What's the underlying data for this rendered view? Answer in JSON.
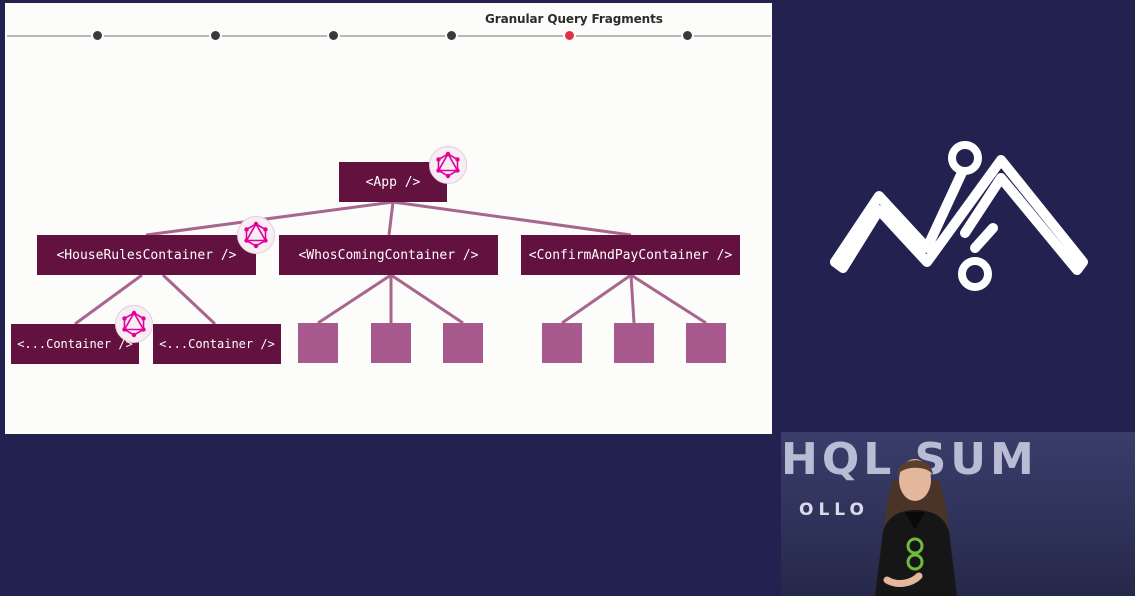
{
  "slide": {
    "timeline": {
      "title": "Granular Query Fragments",
      "active_step": 5,
      "step_count": 6
    },
    "tree": {
      "root": "<App />",
      "children": [
        "<HouseRulesContainer />",
        "<WhosComingContainer />",
        "<ConfirmAndPayContainer />"
      ],
      "house_rules_children": [
        "<...Container />",
        "<...Container />"
      ],
      "whos_coming_leaf_count": 3,
      "confirm_pay_leaf_count": 3,
      "graphql_badge_count": 3
    },
    "colors": {
      "node": "#63113f",
      "leaf": "#a85a8f",
      "connector": "#a8668f",
      "badge_icon": "#e10098",
      "active_dot": "#e3304a"
    }
  },
  "brand": {
    "icon": "apollo-logo-icon"
  },
  "video": {
    "backdrop_text": "HQL SUM",
    "backdrop_subtext": "OLLO"
  }
}
